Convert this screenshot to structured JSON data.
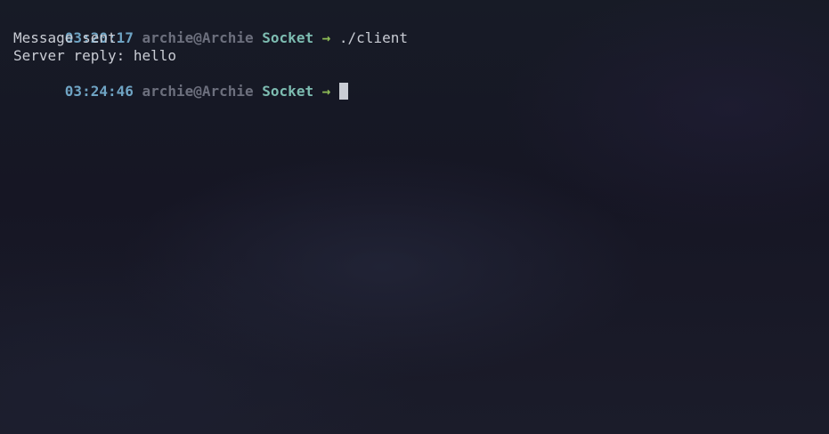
{
  "colors": {
    "time": "#6fa4c4",
    "user": "#6c6f7d",
    "dir": "#7dbcb1",
    "arrow": "#8dbb56",
    "text": "#c9ccd4",
    "cursor": "#c9ccd4"
  },
  "lines": [
    {
      "type": "prompt",
      "time": "03:20:17",
      "user_host": "archie@Archie",
      "dir": "Socket",
      "arrow": "→",
      "command": "./client"
    },
    {
      "type": "output",
      "text": "Message sent"
    },
    {
      "type": "output",
      "text": "Server reply: hello"
    },
    {
      "type": "prompt",
      "time": "03:24:46",
      "user_host": "archie@Archie",
      "dir": "Socket",
      "arrow": "→",
      "command": ""
    }
  ]
}
